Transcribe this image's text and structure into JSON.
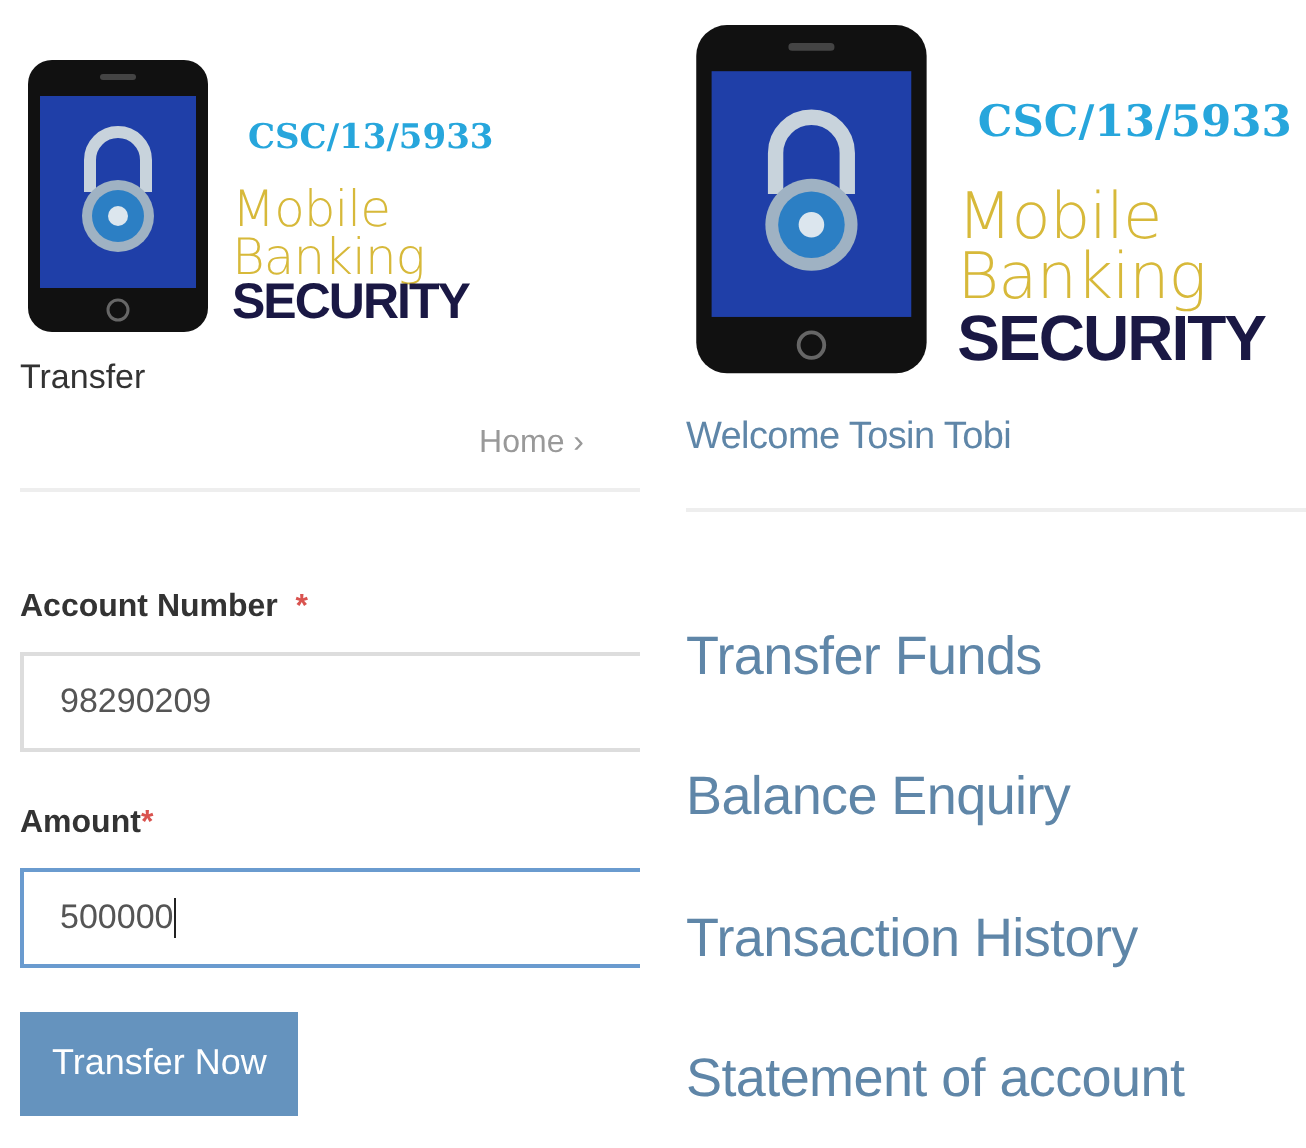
{
  "transfer_screen": {
    "logo": {
      "code": "CSC/13/5933",
      "line_1": "Mobile",
      "line_2": "Banking",
      "line_3": "SECURITY"
    },
    "page_title": "Transfer",
    "breadcrumb": "Home",
    "breadcrumb_separator": "›",
    "fields": [
      {
        "label": "Account Number",
        "required_mark": "*",
        "value": "98290209",
        "focused": false
      },
      {
        "label": "Amount",
        "required_mark": "*",
        "value": "500000",
        "focused": true
      }
    ],
    "button": "Transfer Now"
  },
  "menu_screen": {
    "logo": {
      "code": "CSC/13/5933",
      "line_1": "Mobile",
      "line_2": "Banking",
      "line_3": "SECURITY"
    },
    "welcome": "Welcome Tosin Tobi",
    "menu": [
      "Transfer Funds",
      "Balance Enquiry",
      "Transaction History",
      "Statement of account"
    ]
  }
}
